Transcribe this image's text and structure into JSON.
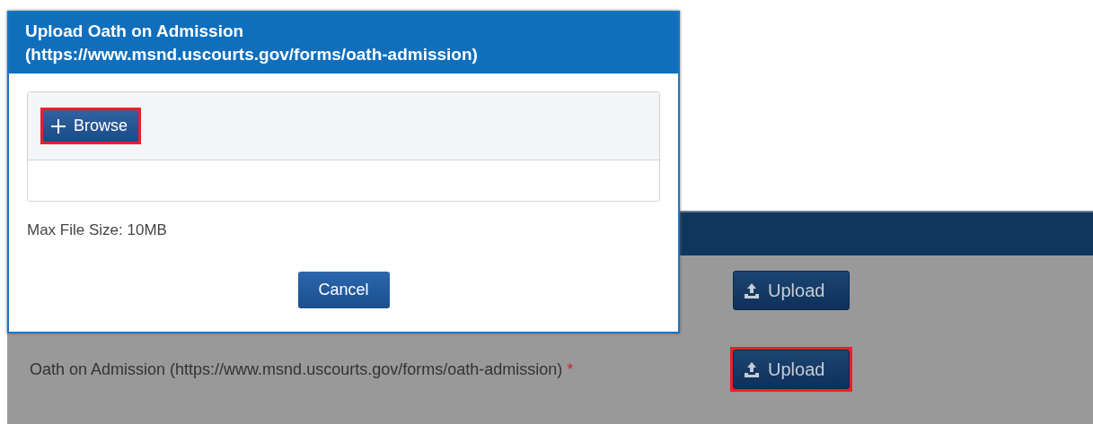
{
  "dialog": {
    "title": "Upload Oath on Admission (https://www.msnd.uscourts.gov/forms/oath-admission)",
    "browse_button": {
      "label": "Browse",
      "highlighted": true
    },
    "note": "Max File Size: 10MB",
    "cancel_button": "Cancel"
  },
  "page": {
    "rows": [
      {
        "button": {
          "label": "Upload",
          "highlighted": false
        }
      },
      {
        "label": "Oath on Admission (https://www.msnd.uscourts.gov/forms/oath-admission)",
        "required_mark": "*",
        "button": {
          "label": "Upload",
          "highlighted": true
        }
      }
    ]
  }
}
